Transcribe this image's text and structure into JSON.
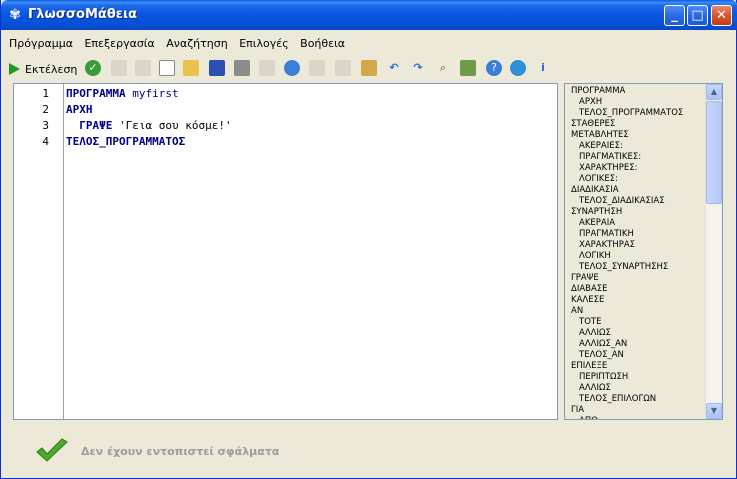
{
  "window": {
    "title": "ΓλωσσοΜάθεια"
  },
  "menu": [
    "Πρόγραμμα",
    "Επεξεργασία",
    "Αναζήτηση",
    "Επιλογές",
    "Βοήθεια"
  ],
  "toolbar": {
    "run_label": "Εκτέλεση",
    "icons": [
      "check-icon",
      "blank-icon",
      "blank-icon",
      "new-file-icon",
      "open-folder-icon",
      "save-icon",
      "print-icon",
      "blank-icon",
      "web-icon",
      "blank-icon",
      "blank-icon",
      "paste-icon",
      "undo-icon",
      "redo-icon",
      "find-icon",
      "replace-icon",
      "help-icon",
      "globe-icon",
      "info-icon"
    ]
  },
  "editor": {
    "line_numbers": [
      "1",
      "2",
      "3",
      "4"
    ],
    "lines": [
      {
        "kw": "ΠΡΟΓΡΑΜΜΑ",
        "rest": " myfirst"
      },
      {
        "kw": "ΑΡΧΗ",
        "rest": ""
      },
      {
        "kw": "  ΓΡΑΨΕ",
        "rest": " 'Γεια σου κόσμε!'"
      },
      {
        "kw": "ΤΕΛΟΣ_ΠΡΟΓΡΑΜΜΑΤΟΣ",
        "rest": ""
      }
    ]
  },
  "keywords": [
    {
      "text": "ΠΡΟΓΡΑΜΜΑ",
      "indent": false
    },
    {
      "text": "ΑΡΧΗ",
      "indent": true
    },
    {
      "text": "ΤΕΛΟΣ_ΠΡΟΓΡΑΜΜΑΤΟΣ",
      "indent": true
    },
    {
      "text": "ΣΤΑΘΕΡΕΣ",
      "indent": false
    },
    {
      "text": "ΜΕΤΑΒΛΗΤΕΣ",
      "indent": false
    },
    {
      "text": "ΑΚΕΡΑΙΕΣ:",
      "indent": true
    },
    {
      "text": "ΠΡΑΓΜΑΤΙΚΕΣ:",
      "indent": true
    },
    {
      "text": "ΧΑΡΑΚΤΗΡΕΣ:",
      "indent": true
    },
    {
      "text": "ΛΟΓΙΚΕΣ:",
      "indent": true
    },
    {
      "text": "ΔΙΑΔΙΚΑΣΙΑ",
      "indent": false
    },
    {
      "text": "ΤΕΛΟΣ_ΔΙΑΔΙΚΑΣΙΑΣ",
      "indent": true
    },
    {
      "text": "ΣΥΝΑΡΤΗΣΗ",
      "indent": false
    },
    {
      "text": "ΑΚΕΡΑΙΑ",
      "indent": true
    },
    {
      "text": "ΠΡΑΓΜΑΤΙΚΗ",
      "indent": true
    },
    {
      "text": "ΧΑΡΑΚΤΗΡΑΣ",
      "indent": true
    },
    {
      "text": "ΛΟΓΙΚΗ",
      "indent": true
    },
    {
      "text": "ΤΕΛΟΣ_ΣΥΝΑΡΤΗΣΗΣ",
      "indent": true
    },
    {
      "text": "ΓΡΑΨΕ",
      "indent": false
    },
    {
      "text": "ΔΙΑΒΑΣΕ",
      "indent": false
    },
    {
      "text": "ΚΑΛΕΣΕ",
      "indent": false
    },
    {
      "text": "ΑΝ",
      "indent": false
    },
    {
      "text": "ΤΟΤΕ",
      "indent": true
    },
    {
      "text": "ΑΛΛΙΩΣ",
      "indent": true
    },
    {
      "text": "ΑΛΛΙΩΣ_ΑΝ",
      "indent": true
    },
    {
      "text": "ΤΕΛΟΣ_ΑΝ",
      "indent": true
    },
    {
      "text": "ΕΠΙΛΕΞΕ",
      "indent": false
    },
    {
      "text": "ΠΕΡΙΠΤΩΣΗ",
      "indent": true
    },
    {
      "text": "ΑΛΛΙΩΣ",
      "indent": true
    },
    {
      "text": "ΤΕΛΟΣ_ΕΠΙΛΟΓΩΝ",
      "indent": true
    },
    {
      "text": "ΓΙΑ",
      "indent": false
    },
    {
      "text": "ΑΠΟ",
      "indent": true
    }
  ],
  "status": {
    "text": "Δεν έχουν εντοπιστεί σφάλματα"
  }
}
